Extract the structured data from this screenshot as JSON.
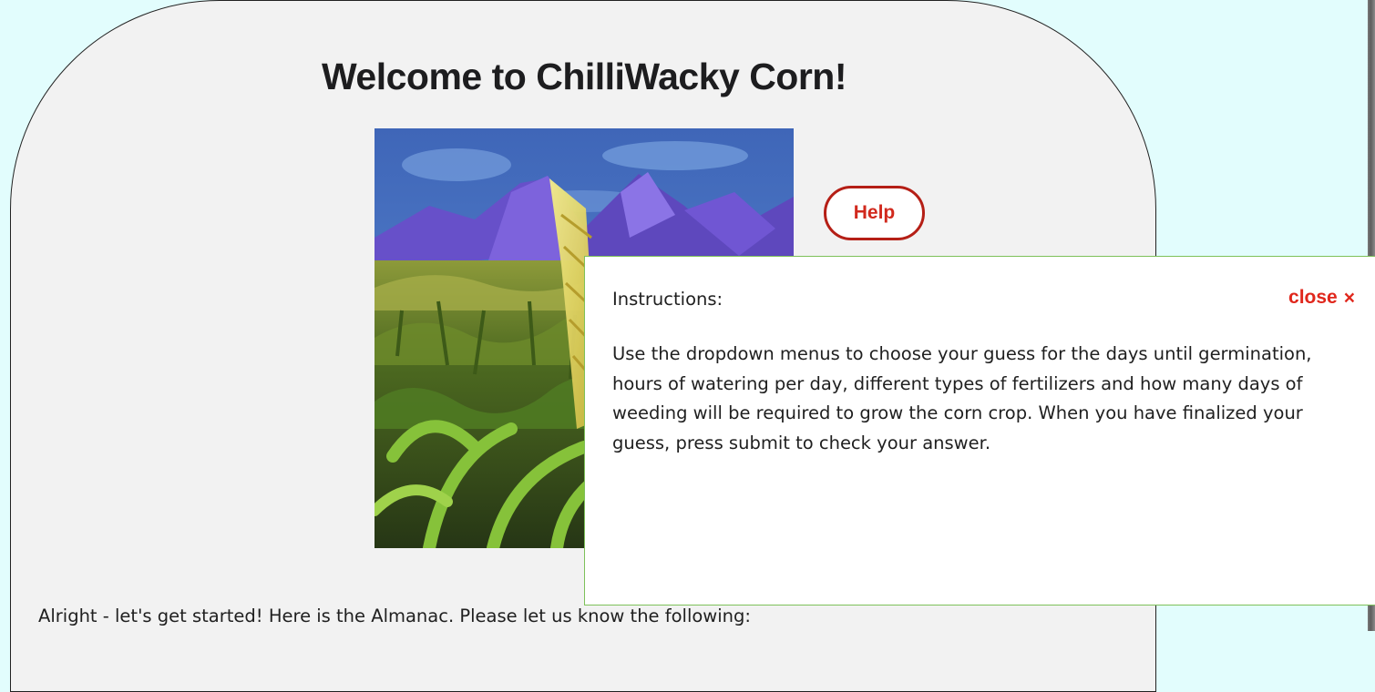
{
  "page": {
    "title": "Welcome to ChilliWacky Corn!",
    "hero_image_alt": "Corn field in front of purple mountains",
    "intro_text": "Alright - let's get started! Here is the Almanac. Please let us know the following:"
  },
  "help": {
    "label": "Help"
  },
  "modal": {
    "heading": "Instructions:",
    "close_label": "close",
    "close_icon": "×",
    "body": "Use the dropdown menus to choose your guess for the days until germination, hours of watering per day, different types of fertilizers and how many days of weeding will be required to grow the corn crop. When you have finalized your guess, press submit to check your answer."
  },
  "colors": {
    "page_background": "#e2fdfd",
    "card_background": "#f2f2f2",
    "accent_red": "#d1291d",
    "modal_border": "#7ec15a"
  }
}
